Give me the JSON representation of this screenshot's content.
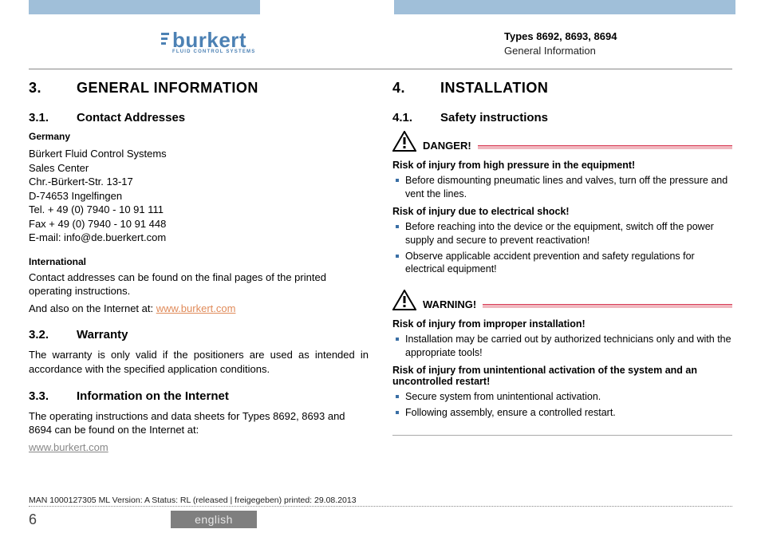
{
  "logo": {
    "brand": "burkert",
    "tag": "FLUID CONTROL SYSTEMS"
  },
  "header": {
    "types": "Types 8692, 8693, 8694",
    "sub": "General Information"
  },
  "left": {
    "h1_num": "3.",
    "h1": "GENERAL INFORMATION",
    "s1_num": "3.1.",
    "s1": "Contact Addresses",
    "germany": "Germany",
    "addr1": "Bürkert Fluid Control Systems",
    "addr2": "Sales Center",
    "addr3": "Chr.-Bürkert-Str. 13-17",
    "addr4": "D-74653 Ingelfingen",
    "addr5": "Tel.  + 49 (0) 7940 - 10 91 111",
    "addr6": "Fax  + 49 (0) 7940 - 10 91 448",
    "addr7": "E-mail: info@de.buerkert.com",
    "intl": "International",
    "intl_p1": "Contact addresses can be found on the final pages of the printed operating instructions.",
    "intl_p2a": "And also on the Internet at: ",
    "intl_link": "www.burkert.com",
    "s2_num": "3.2.",
    "s2": "Warranty",
    "warranty_p": "The warranty is only valid if the positioners are used as intended in accordance with the specified application conditions.",
    "s3_num": "3.3.",
    "s3": "Information on the Internet",
    "info_p": "The operating instructions and data sheets for Types 8692, 8693 and 8694 can be found on the Internet at:",
    "info_link": "www.burkert.com "
  },
  "right": {
    "h1_num": "4.",
    "h1": "INSTALLATION",
    "s1_num": "4.1.",
    "s1": "Safety instructions",
    "danger": "DANGER!",
    "d_r1": "Risk of injury from high pressure in the equipment!",
    "d_b1": "Before dismounting pneumatic lines and valves, turn off the pressure and vent the lines.",
    "d_r2": "Risk of injury due to electrical shock!",
    "d_b2": "Before reaching into the device or the equipment, switch off the power supply and secure to prevent reactivation!",
    "d_b3": "Observe applicable accident prevention and safety regulations for electrical equipment!",
    "warning": "WARNING!",
    "w_r1": "Risk of injury from improper installation!",
    "w_b1": "Installation may be carried out by authorized technicians only and with the appropriate tools!",
    "w_r2": "Risk of injury from unintentional activation of the system and an uncontrolled restart!",
    "w_b2": "Secure system from unintentional activation.",
    "w_b3": "Following assembly, ensure a controlled restart."
  },
  "footer": {
    "line": "MAN  1000127305  ML  Version: A Status: RL (released | freigegeben)  printed: 29.08.2013",
    "page": "6",
    "lang": "english"
  }
}
